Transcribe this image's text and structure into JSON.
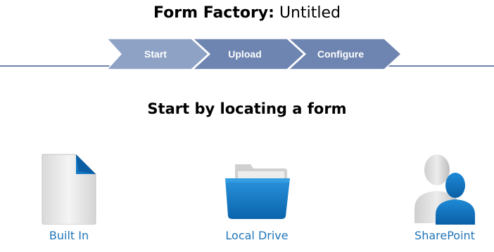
{
  "header": {
    "app_name": "Form Factory:",
    "document_name": "Untitled"
  },
  "wizard": {
    "steps": [
      {
        "label": "Start",
        "state": "active"
      },
      {
        "label": "Upload",
        "state": "inactive"
      },
      {
        "label": "Configure",
        "state": "inactive"
      }
    ],
    "colors": {
      "active": "#8ea2c6",
      "inactive": "#6e85b1",
      "line": "#6d84ad"
    }
  },
  "main": {
    "heading": "Start by locating a form",
    "sources": [
      {
        "label": "Built In",
        "icon": "document-icon"
      },
      {
        "label": "Local Drive",
        "icon": "folder-icon"
      },
      {
        "label": "SharePoint",
        "icon": "users-icon"
      }
    ],
    "accent_color": "#1f74b8"
  }
}
